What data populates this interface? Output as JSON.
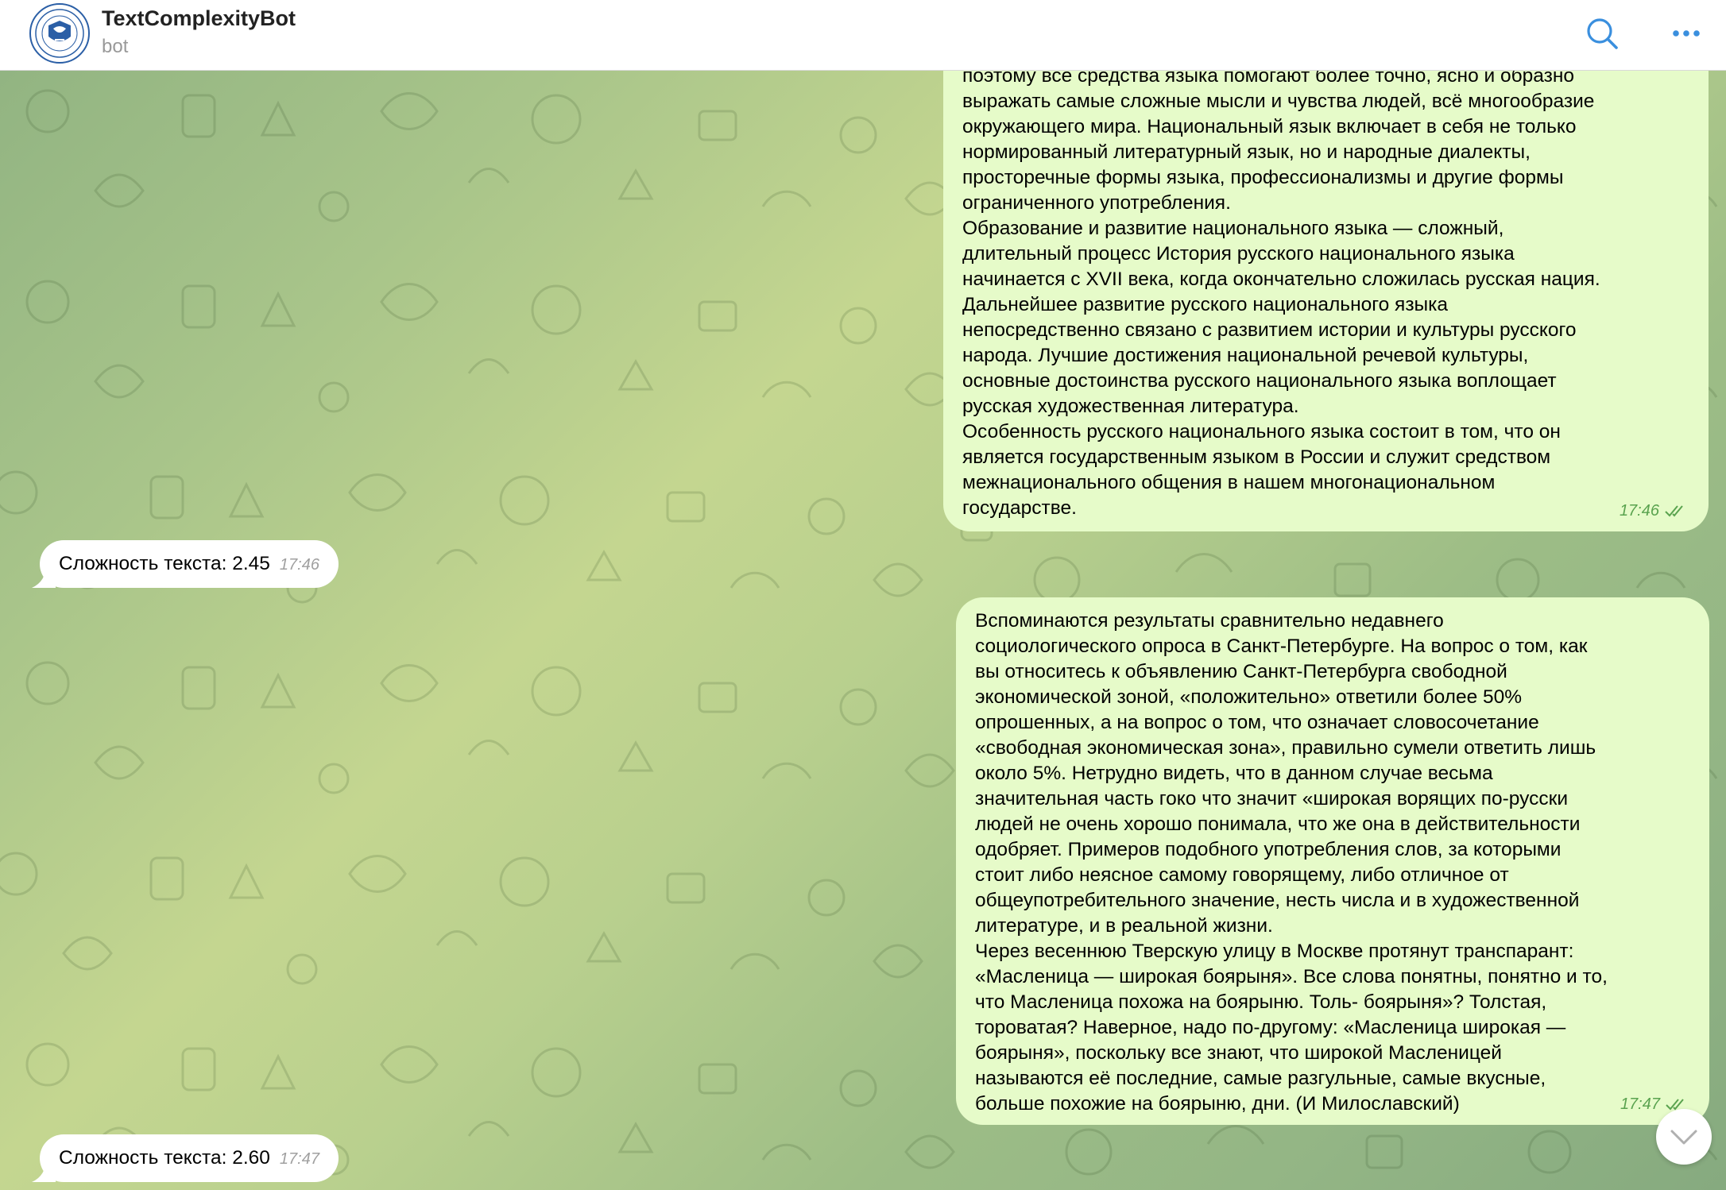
{
  "header": {
    "bot_name": "TextComplexityBot",
    "status": "bot"
  },
  "messages": [
    {
      "direction": "outgoing",
      "text": "поэтому все средства языка помогают более точно, ясно и образно\nвыражать самые сложные мысли и чувства людей, всё многообразие\nокружающего мира. Национальный язык включает в себя не только\nнормированный литературный язык, но и народные диалекты,\nпросторечные формы языка, профессионализмы и другие формы\nограниченного употребления.\nОбразование и развитие национального языка — сложный,\nдлительный процесс История русского национального языка\nначинается с XVII века, когда окончательно сложилась русская нация.\nДальнейшее развитие русского национального языка\nнепосредственно связано с развитием истории и культуры русского\nнарода. Лучшие достижения национальной речевой культуры,\nосновные достоинства русского национального языка воплощает\nрусская художественная литература.\nОсобенность русского национального языка состоит в том, что он\nявляется государственным языком в России и служит средством\nмежнационального общения в нашем многонациональном\nгосударстве.",
      "time": "17:46"
    },
    {
      "direction": "incoming",
      "text": "Сложность текста: 2.45",
      "time": "17:46"
    },
    {
      "direction": "outgoing",
      "text": "Вспоминаются результаты сравнительно недавнего\nсоциологического опроса в Санкт-Петербурге. На вопрос о том, как\nвы относитесь к объявлению Санкт-Петербурга свободной\nэкономической зоной, «положительно» ответили более 50%\nопрошенных, а на вопрос о том, что означает словосочетание\n«свободная экономическая зона», правильно сумели ответить лишь\nоколо 5%. Нетрудно видеть, что в данном случае весьма\nзначительная часть гоко что значит «широкая ворящих по-русски\nлюдей не очень хорошо понимала, что же она в действительности\nодобряет. Примеров подобного употребления слов, за которыми\nстоит либо неясное самому говорящему, либо отличное от\nобщеупотребительного значение, несть числа и в художественной\nлитературе, и в реальной жизни.\nЧерез весеннюю Тверскую улицу в Москве протянут транспарант:\n«Масленица — широкая боярыня». Все слова понятны, понятно и то,\nчто Масленица похожа на боярыню. Толь- боярыня»? Толстая,\nтороватая? Наверное, надо по-другому: «Масленица широкая —\nбоярыня», поскольку все знают, что широкой Масленицей\nназываются её последние, самые разгульные, самые вкусные,\nбольше похожие на боярыню, дни. (И Милославский)",
      "time": "17:47"
    },
    {
      "direction": "incoming",
      "text": "Сложность текста: 2.60",
      "time": "17:47"
    }
  ],
  "icons": {
    "search": "search-icon",
    "more": "more-icon",
    "read_receipt": "double-check-icon",
    "scroll_down": "chevron-down-icon",
    "avatar": "university-logo"
  },
  "colors": {
    "outgoing_bubble": "#e6fbc9",
    "incoming_bubble": "#ffffff",
    "accent": "#3a8fde",
    "time_outgoing": "#5aa34f"
  }
}
